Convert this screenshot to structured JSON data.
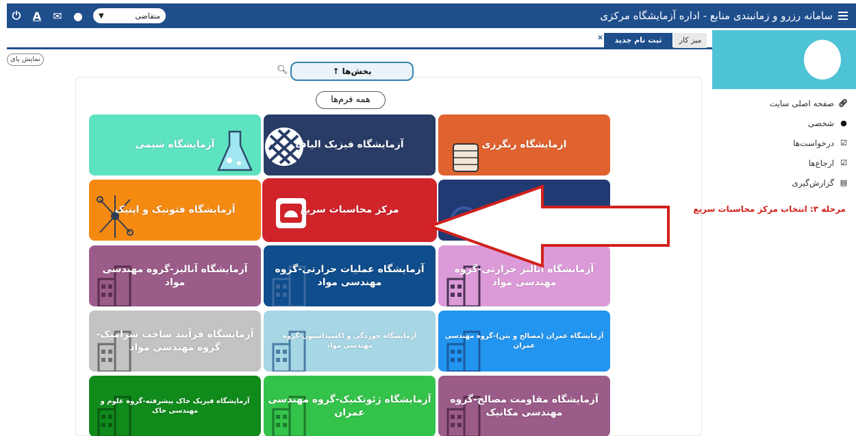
{
  "header": {
    "title": "سامانه رزرو و زمانبندی منابع - اداره آزمایشگاه مرکزی",
    "role_select": "متقاضی",
    "icons": [
      "power-icon",
      "font-icon",
      "mail-icon",
      "user-icon"
    ]
  },
  "tabs": {
    "desk": "میز کار",
    "new_registration": "ثبت نام جدید",
    "close": "×"
  },
  "sidebar": {
    "items": [
      {
        "label": "صفحه اصلی سایت",
        "icon": "link-icon"
      },
      {
        "label": "شخصی",
        "icon": "user-icon"
      },
      {
        "label": "درخواست‌ها",
        "icon": "check-icon"
      },
      {
        "label": "ارجاع‌ها",
        "icon": "check-icon"
      },
      {
        "label": "گزارش‌گیری",
        "icon": "report-icon"
      }
    ]
  },
  "toolbar": {
    "show_button": "نمایش پای",
    "sections_button": "بخش‌ها ↑",
    "all_forms": "همه فرم‌ها"
  },
  "annotation": {
    "step_text": "مرحله ۳: انتخاب مرکز محاسبات سریع"
  },
  "tiles": [
    {
      "label": "ازمایشگاه رنگرزی",
      "color": "#e0622f"
    },
    {
      "label": "آزمایشگاه فیزیک الیاف",
      "color": "#283c66"
    },
    {
      "label": "آزمایشگاه شیمی",
      "color": "#5ee3c0"
    },
    {
      "label": "",
      "color": "#213a73"
    },
    {
      "label": "مرکز محاسبات سریع",
      "color": "#d0232a"
    },
    {
      "label": "آزمایشگاه فتونیک و اپتیک",
      "color": "#f58a11"
    },
    {
      "label": "آزمایشگاه آنالیز حرارتی-گروه مهندسی مواد",
      "color": "#dc9ad8"
    },
    {
      "label": "آزمایشگاه عملیات حرارتی-گروه مهندسی مواد",
      "color": "#0f4d8c"
    },
    {
      "label": "آزمایشگاه آنالیز-گروه مهندسی مواد",
      "color": "#9b5c8a"
    },
    {
      "label": "آزمایشگاه عمران (مصالح و بتن)-گروه مهندسی عمران",
      "color": "#2295f0"
    },
    {
      "label": "آزمایشگاه خوردگی و اکسیداسیون-گروه مهندسی مواد",
      "color": "#a7d6e4"
    },
    {
      "label": "آزمایشگاه فرآیند ساخت سرامیک-گروه مهندسی مواد",
      "color": "#c3c3c3"
    },
    {
      "label": "آزمایشگاه مقاومت مصالح-گروه مهندسی مکانیک",
      "color": "#9b5c8a"
    },
    {
      "label": "آزمایشگاه ژئوتکنیک-گروه مهندسی عمران",
      "color": "#34c34a"
    },
    {
      "label": "آزمایشگاه فیزیک خاک پیشرفته-گروه علوم و مهندسی خاک",
      "color": "#118a1c"
    }
  ]
}
